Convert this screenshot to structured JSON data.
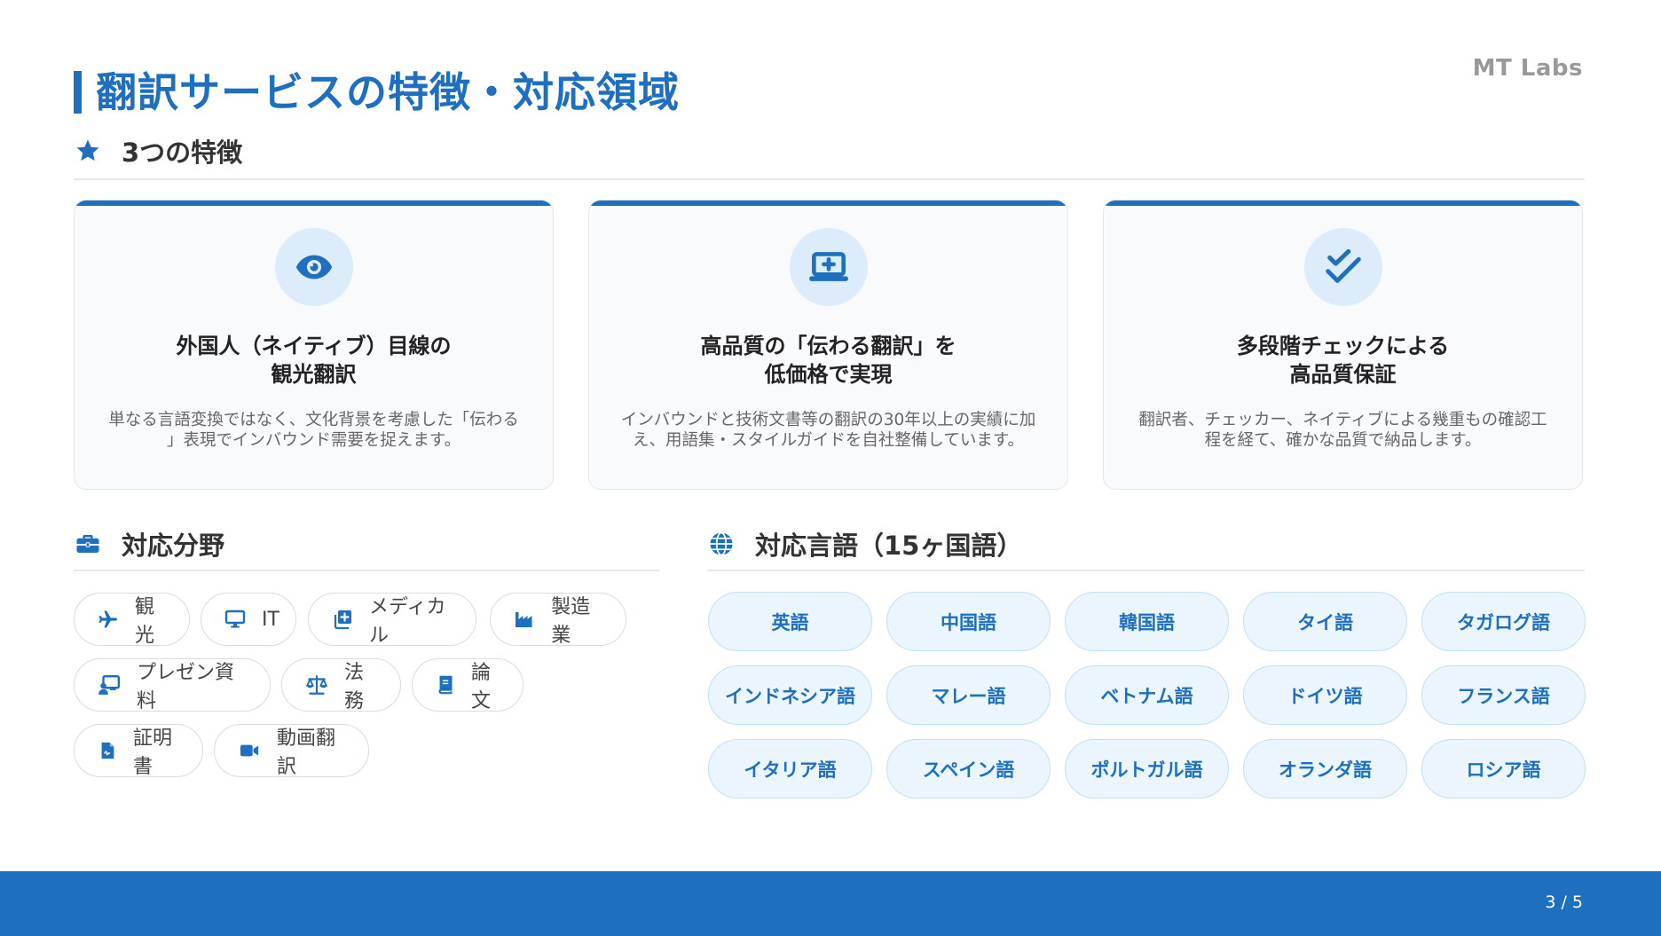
{
  "brand": "MT Labs",
  "title": "翻訳サービスの特徴・対応領域",
  "features_section": {
    "label": "3つの特徴",
    "icon": "star-icon"
  },
  "features": [
    {
      "icon": "eye-icon",
      "title_line1": "外国人（ネイティブ）目線の",
      "title_line2": "観光翻訳",
      "desc_line1": "単なる言語変換ではなく、文化背景を考慮した「伝わる",
      "desc_line2": "」表現でインバウンド需要を捉えます。"
    },
    {
      "icon": "laptop-medical-icon",
      "title_line1": "高品質の「伝わる翻訳」を",
      "title_line2": "低価格で実現",
      "desc_line1": "インバウンドと技術文書等の翻訳の30年以上の実績に加",
      "desc_line2": "え、用語集・スタイルガイドを自社整備しています。"
    },
    {
      "icon": "double-check-icon",
      "title_line1": "多段階チェックによる",
      "title_line2": "高品質保証",
      "desc_line1": "翻訳者、チェッカー、ネイティブによる幾重もの確認工",
      "desc_line2": "程を経て、確かな品質で納品します。"
    }
  ],
  "fields_section": {
    "label": "対応分野",
    "icon": "briefcase-icon"
  },
  "fields": [
    {
      "label": "観光",
      "icon": "plane-icon"
    },
    {
      "label": "IT",
      "icon": "desktop-icon"
    },
    {
      "label": "メディカル",
      "icon": "medical-icon"
    },
    {
      "label": "製造業",
      "icon": "industry-icon"
    },
    {
      "label": "プレゼン資料",
      "icon": "presentation-icon"
    },
    {
      "label": "法務",
      "icon": "scale-icon"
    },
    {
      "label": "論文",
      "icon": "book-icon"
    },
    {
      "label": "証明書",
      "icon": "certificate-icon"
    },
    {
      "label": "動画翻訳",
      "icon": "video-icon"
    }
  ],
  "languages_section": {
    "label": "対応言語（15ヶ国語）",
    "icon": "globe-icon"
  },
  "languages": [
    "英語",
    "中国語",
    "韓国語",
    "タイ語",
    "タガログ語",
    "インドネシア語",
    "マレー語",
    "ベトナム語",
    "ドイツ語",
    "フランス語",
    "イタリア語",
    "スペイン語",
    "ポルトガル語",
    "オランダ語",
    "ロシア語"
  ],
  "page_indicator": "3 / 5",
  "colors": {
    "accent": "#1e6fbf",
    "accent_light": "#dcecfb",
    "lang_bg": "#eaf5fd"
  }
}
